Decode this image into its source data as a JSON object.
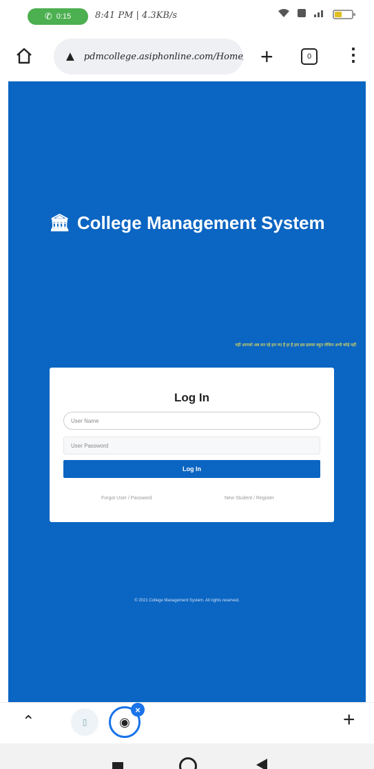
{
  "status_bar": {
    "call_label": "0:15",
    "left_text": "8:41 PM | 4.3KB/s",
    "icons": [
      "phone-icon",
      "whatsapp-icon",
      "wifi-icon",
      "signal-icon",
      "battery-icon"
    ]
  },
  "browser": {
    "url": "pdmcollege.asiphonline.com/Home/Login",
    "tab_count": "0"
  },
  "page": {
    "app_title": "College Management System",
    "marquee": "नहीं आपको अब कर रहे हम नए हैं हा है इस इस इसका बहुत लेकिन अभी कोई नहीं",
    "login": {
      "title": "Log In",
      "username_placeholder": "User Name",
      "password_placeholder": "User Password",
      "button_label": "Log In",
      "forgot_link": "Forgot User / Password",
      "register_link": "New Student / Register"
    },
    "footer": "© 2021 College Management System. All rights reserved."
  },
  "colors": {
    "primary": "#0b65c2",
    "marquee": "#ffe94d",
    "call": "#4caf50",
    "tab_ring": "#1a73e8"
  }
}
